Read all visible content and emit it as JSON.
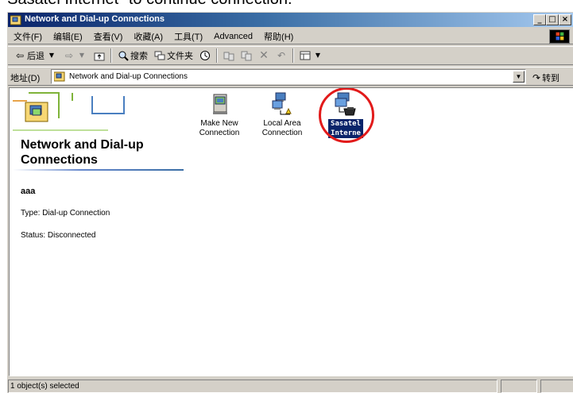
{
  "caption": "\"Sasatel Internet\" to continue connection.",
  "window": {
    "title": "Network and Dial-up Connections",
    "buttons": [
      "_",
      "□",
      "×"
    ]
  },
  "menu": {
    "items": [
      "文件(F)",
      "编辑(E)",
      "查看(V)",
      "收藏(A)",
      "工具(T)",
      "Advanced",
      "帮助(H)"
    ]
  },
  "toolbar": {
    "back": "后退",
    "search": "搜索",
    "folders": "文件夹"
  },
  "address": {
    "label": "地址(D)",
    "value": "Network and Dial-up Connections",
    "go": "转到"
  },
  "panel": {
    "title": "Network and Dial-up Connections",
    "item_name": "aaa",
    "type": "Type: Dial-up Connection",
    "status": "Status: Disconnected"
  },
  "icons": [
    {
      "label": "Make New\nConnection",
      "icon": "make-new-connection-icon"
    },
    {
      "label": "Local Area\nConnection",
      "icon": "local-area-connection-icon"
    },
    {
      "label": "Sasatel\nInterne",
      "icon": "dialup-connection-icon"
    }
  ],
  "statusbar": {
    "text": "1 object(s) selected"
  },
  "colors": {
    "title_start": "#0a246a",
    "title_end": "#a6caf0",
    "chrome": "#d4d0c8",
    "selection": "#0a246a",
    "highlight_ring": "#e21a1a"
  }
}
